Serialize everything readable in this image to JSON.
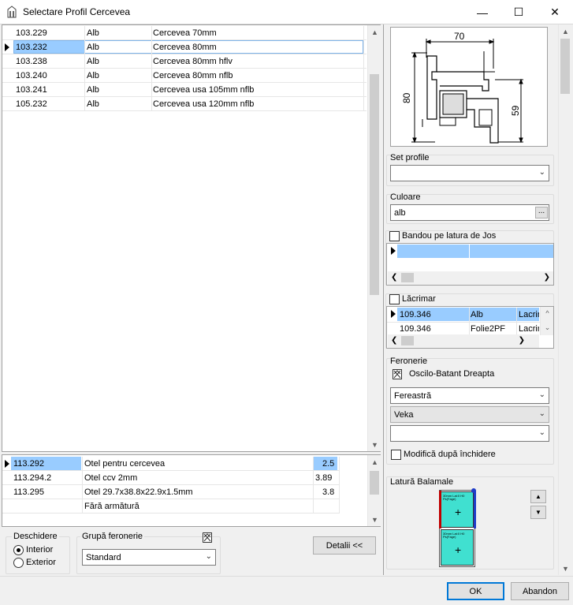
{
  "window": {
    "title": "Selectare Profil Cercevea",
    "app_icon": "window-profile-icon",
    "minimize_glyph": "—",
    "maximize_glyph": "☐",
    "close_glyph": "✕"
  },
  "profiles_grid": {
    "rows": [
      {
        "code": "103.229",
        "color": "Alb",
        "name": "Cercevea 70mm",
        "selected": false
      },
      {
        "code": "103.232",
        "color": "Alb",
        "name": "Cercevea 80mm",
        "selected": true
      },
      {
        "code": "103.238",
        "color": "Alb",
        "name": "Cercevea 80mm hflv",
        "selected": false
      },
      {
        "code": "103.240",
        "color": "Alb",
        "name": "Cercevea 80mm nflb",
        "selected": false
      },
      {
        "code": "103.241",
        "color": "Alb",
        "name": "Cercevea usa 105mm nflb",
        "selected": false
      },
      {
        "code": "105.232",
        "color": "Alb",
        "name": "Cercevea usa 120mm nflb",
        "selected": false
      }
    ]
  },
  "reinforcement_grid": {
    "rows": [
      {
        "code": "113.292",
        "name": "Otel pentru cercevea",
        "value": "2.5",
        "selected": true
      },
      {
        "code": "113.294.2",
        "name": "Otel ccv 2mm",
        "value": "3.89",
        "selected": false
      },
      {
        "code": "113.295",
        "name": "Otel 29.7x38.8x22.9x1.5mm",
        "value": "3.8",
        "selected": false
      },
      {
        "code": "",
        "name": "Fără armătură",
        "value": "",
        "selected": false
      }
    ]
  },
  "opening": {
    "group_label": "Deschidere",
    "interior_label": "Interior",
    "exterior_label": "Exterior",
    "selected": "Interior"
  },
  "hardware_group": {
    "label": "Grupă feronerie",
    "value": "Standard",
    "icon": "hardware-group-icon"
  },
  "details_button": "Detalii <<",
  "profile_drawing": {
    "dim_width": "70",
    "dim_height_left": "80",
    "dim_height_right": "59"
  },
  "set_profile": {
    "label": "Set profile",
    "value": ""
  },
  "color": {
    "label": "Culoare",
    "value": "alb",
    "browse": "..."
  },
  "bottom_trim": {
    "label": "Bandou pe latura de Jos",
    "checked": false
  },
  "drip": {
    "label": "Lăcrimar",
    "checked": false,
    "rows": [
      {
        "code": "109.346",
        "color": "Alb",
        "name": "Lacrim",
        "selected": true
      },
      {
        "code": "109.346",
        "color": "Folie2PF",
        "name": "Lacrim",
        "selected": false
      }
    ]
  },
  "hardware": {
    "label": "Feronerie",
    "type_label": "Oscilo-Batant Dreapta",
    "type_icon": "tilt-turn-icon",
    "window_type": "Fereastră",
    "brand": "Veka",
    "extra": "",
    "modify_after_close": "Modifică după închidere"
  },
  "hinge_side": {
    "label": "Latură Balamale",
    "sash_text_top": "30mm Lat:0 H0 Ps(Fage)",
    "sash_text_bottom": "30mm Lat:0 H0 Ps(Fage)"
  },
  "buttons": {
    "ok": "OK",
    "cancel": "Abandon"
  },
  "colors": {
    "selection": "#99ccff",
    "glass": "#40e0d0",
    "hinge_red": "#c00000",
    "hinge_blue": "#1e3cc8",
    "accent": "#0078d7"
  }
}
